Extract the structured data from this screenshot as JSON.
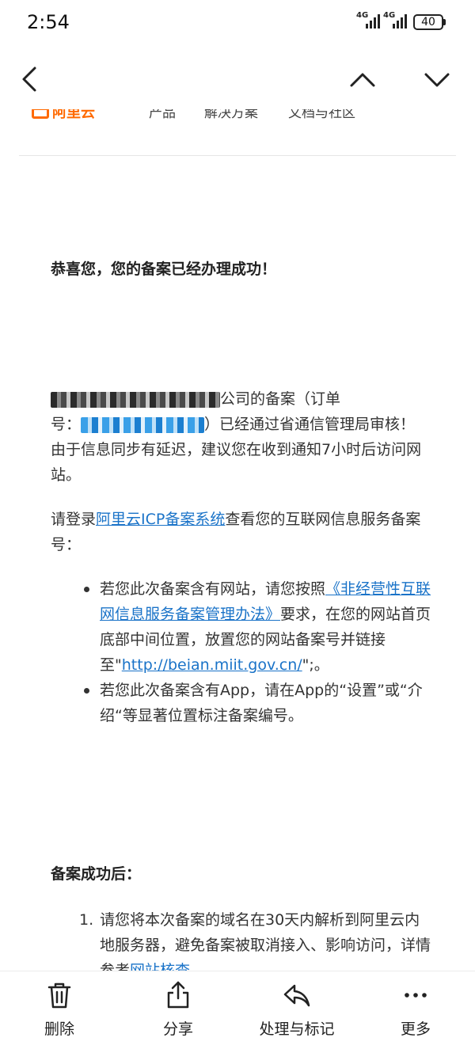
{
  "status": {
    "time": "2:54",
    "net1": "4G",
    "net2": "4G",
    "battery": "40"
  },
  "site_header": {
    "logo_text": "阿里云",
    "nav_items": [
      "产品",
      "解决方案",
      "文档与社区"
    ]
  },
  "email": {
    "congrats": "恭喜您，您的备案已经办理成功！",
    "p1": {
      "company_suffix": "公司的备案（订单",
      "order_prefix": "号：",
      "after_order": "）已经通过省通信管理局审",
      "rest": "核！由于信息同步有延迟，建议您在收到通知7小时后访问网站。"
    },
    "p2": {
      "prefix": "请登录",
      "link": "阿里云ICP备案系统",
      "suffix": "查看您的互联网信息服务备案号："
    },
    "bullets": [
      {
        "prefix": "若您此次备案含有网站，请您按照",
        "link": "《非经营性互联网信息服务备案管理办法》",
        "mid": "要求，在您的网站首页底部中间位置，放置您的网站备案号并链接至\"",
        "url": "http://beian.miit.gov.cn/",
        "end": "\";。"
      },
      {
        "text": "若您此次备案含有App，请在App的“设置”或“介绍“等显著位置标注备案编号。"
      }
    ],
    "after_title": "备案成功后：",
    "steps": [
      {
        "num": "1.",
        "text": "请您将本次备案的域名在30天内解析到阿里云内地服务器，避免备案被取消接入、影响访问，详情参考",
        "link": "网站核查"
      }
    ]
  },
  "toolbar": {
    "delete": "删除",
    "share": "分享",
    "process": "处理与标记",
    "more": "更多"
  },
  "colors": {
    "link": "#1a73c8",
    "brand": "#ff6a00"
  }
}
